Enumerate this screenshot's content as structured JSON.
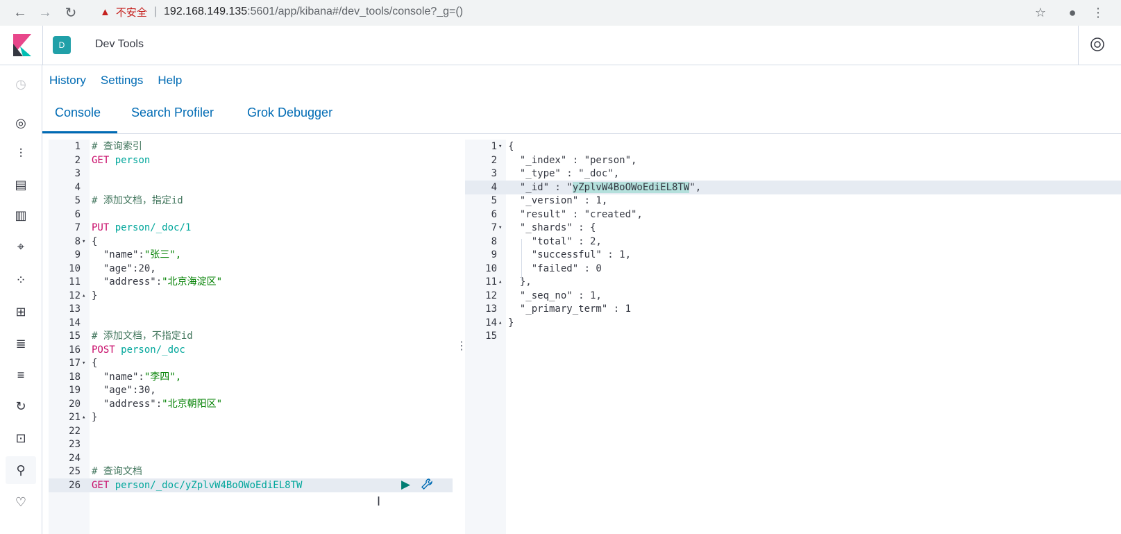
{
  "browser": {
    "back": "←",
    "forward": "→",
    "reload": "↻",
    "warning_label": "不安全",
    "url_host": "192.168.149.135",
    "url_path": ":5601/app/kibana#/dev_tools/console?_g=()",
    "bookmark": "☆",
    "account": "●",
    "menu": "⋮"
  },
  "header": {
    "space_initial": "D",
    "title": "Dev Tools"
  },
  "top_links": [
    "History",
    "Settings",
    "Help"
  ],
  "tabs": [
    "Console",
    "Search Profiler",
    "Grok Debugger"
  ],
  "editor": {
    "lines": [
      {
        "n": "1",
        "t": "# 查询索引",
        "k": "comment"
      },
      {
        "n": "2",
        "m": "GET",
        "u": " person"
      },
      {
        "n": "3",
        "t": ""
      },
      {
        "n": "4",
        "t": ""
      },
      {
        "n": "5",
        "t": "# 添加文档，指定id",
        "k": "comment"
      },
      {
        "n": "6",
        "t": ""
      },
      {
        "n": "7",
        "m": "PUT",
        "u": " person/_doc/1"
      },
      {
        "n": "8",
        "t": "{",
        "f": "▾"
      },
      {
        "n": "9",
        "kv": [
          "  \"name\":",
          "\"张三\","
        ]
      },
      {
        "n": "10",
        "kv": [
          "  \"age\":",
          "20,"
        ]
      },
      {
        "n": "11",
        "kv": [
          "  \"address\":",
          "\"北京海淀区\""
        ]
      },
      {
        "n": "12",
        "t": "}",
        "f": "▴"
      },
      {
        "n": "13",
        "t": ""
      },
      {
        "n": "14",
        "t": ""
      },
      {
        "n": "15",
        "t": "# 添加文档，不指定id",
        "k": "comment"
      },
      {
        "n": "16",
        "m": "POST",
        "u": " person/_doc"
      },
      {
        "n": "17",
        "t": "{",
        "f": "▾"
      },
      {
        "n": "18",
        "kv": [
          "  \"name\":",
          "\"李四\","
        ]
      },
      {
        "n": "19",
        "kv": [
          "  \"age\":",
          "30,"
        ]
      },
      {
        "n": "20",
        "kv": [
          "  \"address\":",
          "\"北京朝阳区\""
        ]
      },
      {
        "n": "21",
        "t": "}",
        "f": "▴"
      },
      {
        "n": "22",
        "t": ""
      },
      {
        "n": "23",
        "t": ""
      },
      {
        "n": "24",
        "t": ""
      },
      {
        "n": "25",
        "t": "# 查询文档",
        "k": "comment"
      },
      {
        "n": "26",
        "m": "GET",
        "u": " person/_doc/yZplvW4BoOWoEdiEL8TW",
        "active": true
      }
    ],
    "run_icon": "▶",
    "wrench_icon": "🔧",
    "cursor_icon": "I",
    "resizer_icon": "⋮"
  },
  "output": {
    "lines": [
      {
        "n": "1",
        "t": "{",
        "f": "▾"
      },
      {
        "n": "2",
        "t": "  \"_index\" : \"person\","
      },
      {
        "n": "3",
        "t": "  \"_type\" : \"_doc\","
      },
      {
        "n": "4",
        "pre": "  \"_id\" : \"",
        "sel": "yZplvW4BoOWoEdiEL8TW",
        "post": "\",",
        "hl": true
      },
      {
        "n": "5",
        "t": "  \"_version\" : 1,"
      },
      {
        "n": "6",
        "t": "  \"result\" : \"created\","
      },
      {
        "n": "7",
        "t": "  \"_shards\" : {",
        "f": "▾"
      },
      {
        "n": "8",
        "t": "    \"total\" : 2,"
      },
      {
        "n": "9",
        "t": "    \"successful\" : 1,"
      },
      {
        "n": "10",
        "t": "    \"failed\" : 0"
      },
      {
        "n": "11",
        "t": "  },",
        "f": "▴"
      },
      {
        "n": "12",
        "t": "  \"_seq_no\" : 1,"
      },
      {
        "n": "13",
        "t": "  \"_primary_term\" : 1"
      },
      {
        "n": "14",
        "t": "}",
        "f": "▴"
      },
      {
        "n": "15",
        "t": ""
      }
    ]
  },
  "side_nav_icons": [
    {
      "name": "recently-viewed-icon",
      "glyph": "◷",
      "dim": true
    },
    {
      "name": "discover-icon",
      "glyph": "◎"
    },
    {
      "name": "visualize-icon",
      "glyph": "⫶"
    },
    {
      "name": "dashboard-icon",
      "glyph": "▤"
    },
    {
      "name": "canvas-icon",
      "glyph": "▥"
    },
    {
      "name": "maps-icon",
      "glyph": "⌖"
    },
    {
      "name": "machine-learning-icon",
      "glyph": "⁘"
    },
    {
      "name": "infrastructure-icon",
      "glyph": "⊞"
    },
    {
      "name": "logs-icon",
      "glyph": "≣"
    },
    {
      "name": "apm-icon",
      "glyph": "≡"
    },
    {
      "name": "uptime-icon",
      "glyph": "↻"
    },
    {
      "name": "siem-icon",
      "glyph": "⊡"
    },
    {
      "name": "dev-tools-icon",
      "glyph": "⚲",
      "active": true
    },
    {
      "name": "monitoring-icon",
      "glyph": "♡"
    }
  ]
}
